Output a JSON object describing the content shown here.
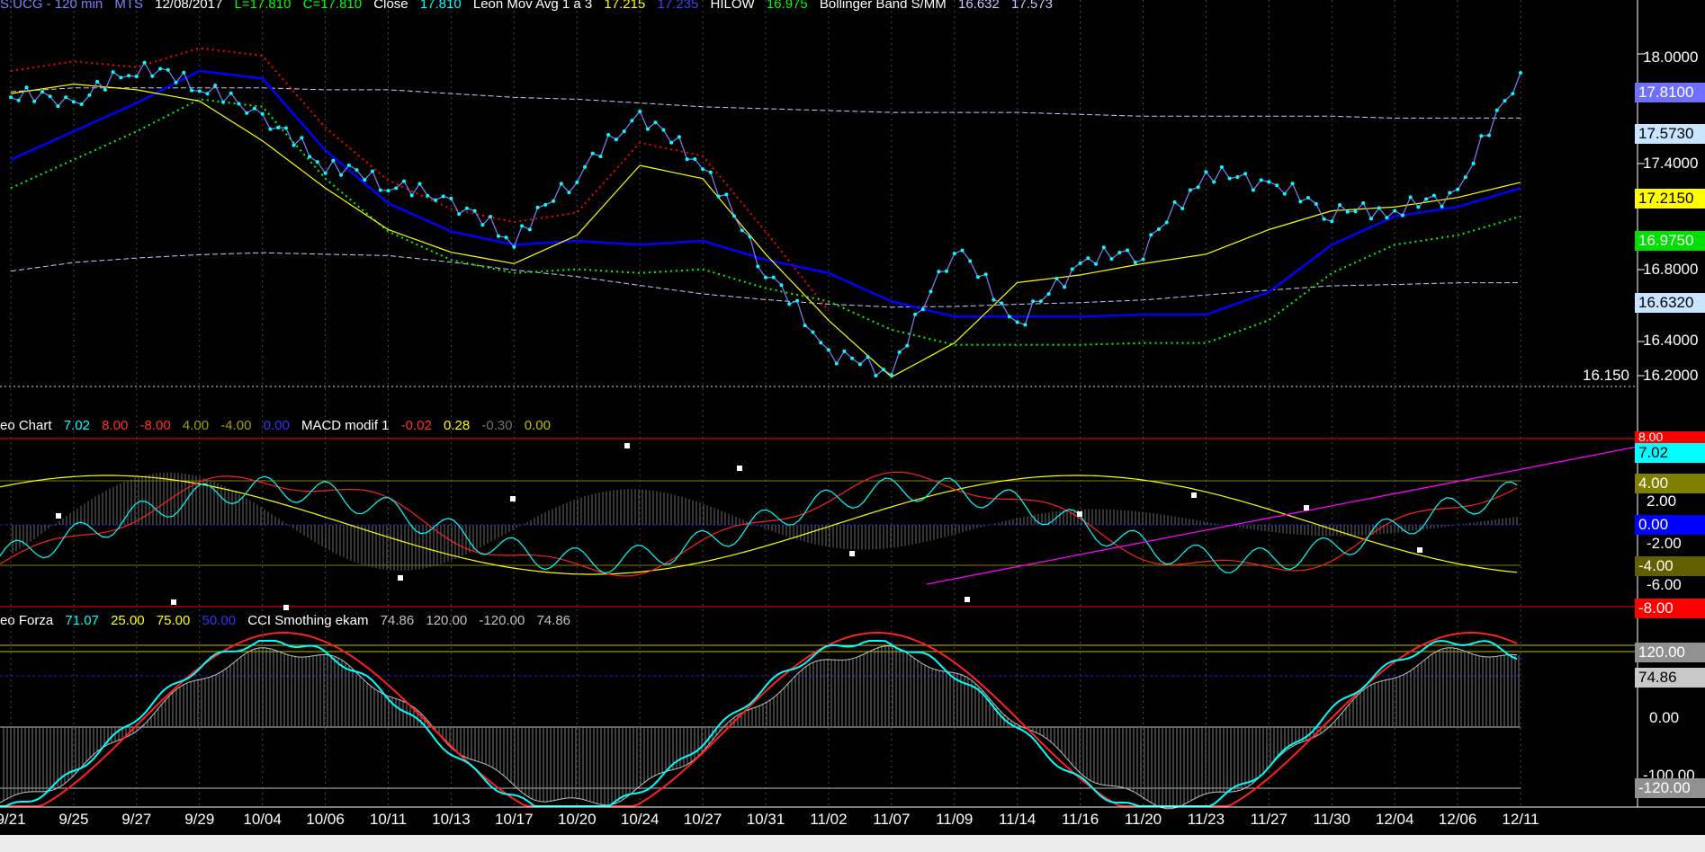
{
  "header_price": {
    "symbol": "S:UCG - 120 min",
    "source": "MTS",
    "date": "12/08/2017",
    "low": "L=17.810",
    "close_eq": "C=17.810",
    "close_label": "Close",
    "close_val": "17.810",
    "mov_avg_label": "Leon Mov Avg 1 a 3",
    "mov_avg_v1": "17.215",
    "mov_avg_v2": "17.235",
    "hilow_label": "HILOW",
    "hilow_val": "16.975",
    "boll_label": "Bollinger Band S/MM",
    "boll_v1": "16.632",
    "boll_v2": "17.573"
  },
  "header_macd": {
    "name": "eo Chart",
    "v1": "7.02",
    "v2": "8.00",
    "v3": "-8.00",
    "v4": "4.00",
    "v5": "-4.00",
    "v6": "0.00",
    "macd_label": "MACD modif 1",
    "m1": "-0.02",
    "m2": "0.28",
    "m3": "-0.30",
    "m4": "0.00"
  },
  "header_forza": {
    "name": "eo Forza",
    "v1": "71.07",
    "v2": "25.00",
    "v3": "75.00",
    "v4": "50.00",
    "cci_label": "CCI Smothing ekam",
    "c1": "74.86",
    "c2": "120.00",
    "c3": "-120.00",
    "c4": "74.86"
  },
  "price_axis": [
    "18.0000",
    "17.4000",
    "16.8000",
    "16.4000",
    "16.2000"
  ],
  "price_tags": {
    "last": "17.8100",
    "boll_upper": "17.5730",
    "mov_avg": "17.2150",
    "hilow": "16.9750",
    "boll_lower": "16.6320"
  },
  "min_label": "16.150",
  "macd_axis": [
    "2.00",
    "-2.00",
    "-6.00"
  ],
  "macd_tags": {
    "top": "8.00",
    "cur": "7.02",
    "t4": "4.00",
    "t0": "0.00",
    "tm4": "-4.00",
    "tm8": "-8.00"
  },
  "forza_axis": [
    "0.00",
    "-100.00"
  ],
  "forza_tags": {
    "t120": "120.00",
    "cur": "74.86",
    "tm120": "-120.00"
  },
  "colors": {
    "background": "#000000",
    "price": "#8080ff",
    "price_dots": "#00ffff",
    "leon_ma": "#ffff00",
    "hilow_blue": "#0000ff",
    "red_dots": "#ff0000",
    "green_dots": "#00ff00",
    "bollinger": "#c8c8ff",
    "macd_cyan": "#00ffff",
    "macd_red": "#ff2020",
    "trendline": "#ff00ff"
  },
  "chart_data": {
    "type": "line",
    "x_dates": [
      "9/21",
      "9/25",
      "9/27",
      "9/29",
      "10/04",
      "10/06",
      "10/11",
      "10/13",
      "10/17",
      "10/20",
      "10/24",
      "10/27",
      "10/31",
      "11/02",
      "11/07",
      "11/09",
      "11/14",
      "11/16",
      "11/20",
      "11/23",
      "11/27",
      "11/30",
      "12/04",
      "12/06",
      "12/11"
    ],
    "ylim": [
      16.15,
      18.1
    ],
    "series": [
      {
        "name": "Close",
        "values": [
          17.68,
          17.62,
          17.82,
          17.72,
          17.55,
          17.3,
          17.2,
          17.1,
          16.9,
          17.25,
          17.56,
          17.3,
          16.75,
          16.3,
          16.2,
          16.88,
          16.45,
          16.78,
          16.85,
          17.25,
          17.2,
          17.05,
          17.05,
          17.15,
          17.81
        ]
      },
      {
        "name": "Leon Mov Avg 1 a 3",
        "values": [
          17.7,
          17.75,
          17.72,
          17.66,
          17.45,
          17.2,
          16.98,
          16.86,
          16.8,
          16.95,
          17.32,
          17.25,
          16.85,
          16.5,
          16.2,
          16.38,
          16.7,
          16.74,
          16.8,
          16.85,
          16.98,
          17.08,
          17.1,
          17.15,
          17.23
        ]
      },
      {
        "name": "HILOW",
        "values": [
          17.35,
          17.5,
          17.65,
          17.82,
          17.78,
          17.4,
          17.12,
          16.97,
          16.9,
          16.92,
          16.9,
          16.92,
          16.82,
          16.75,
          16.6,
          16.52,
          16.52,
          16.52,
          16.53,
          16.53,
          16.65,
          16.9,
          17.05,
          17.1,
          17.2
        ]
      },
      {
        "name": "Bollinger Band S/MM",
        "values": [
          17.71,
          17.73,
          17.73,
          17.73,
          17.73,
          17.72,
          17.72,
          17.7,
          17.68,
          17.67,
          17.65,
          17.63,
          17.62,
          17.61,
          17.6,
          17.6,
          17.6,
          17.59,
          17.58,
          17.58,
          17.58,
          17.58,
          17.57,
          17.57,
          17.57
        ]
      }
    ]
  }
}
